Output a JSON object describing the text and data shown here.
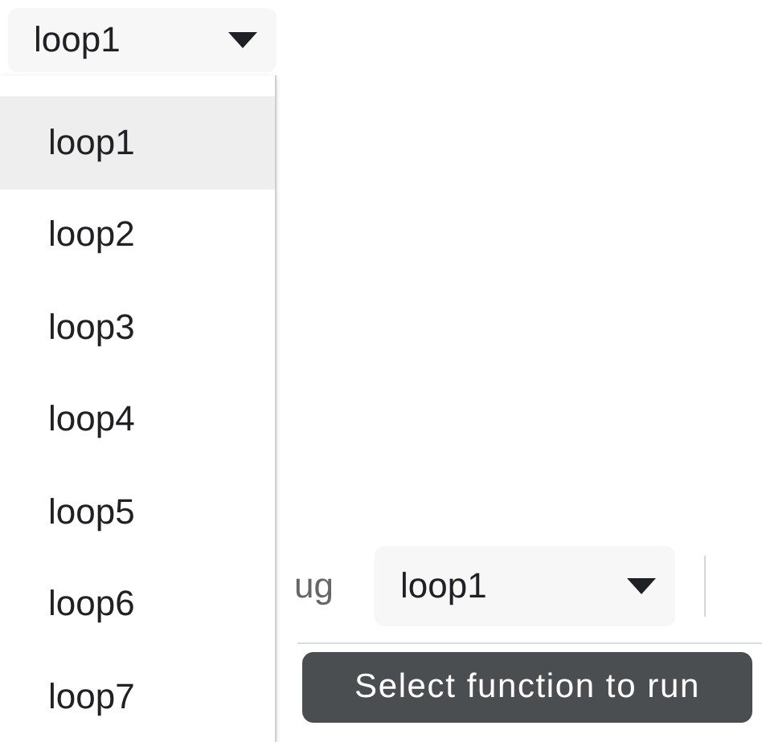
{
  "dropdown": {
    "value": "loop1",
    "expanded": true,
    "options": [
      {
        "label": "loop1",
        "selected": true
      },
      {
        "label": "loop2",
        "selected": false
      },
      {
        "label": "loop3",
        "selected": false
      },
      {
        "label": "loop4",
        "selected": false
      },
      {
        "label": "loop5",
        "selected": false
      },
      {
        "label": "loop6",
        "selected": false
      },
      {
        "label": "loop7",
        "selected": false
      }
    ]
  },
  "toolbar": {
    "label": "ug",
    "select": {
      "value": "loop1"
    }
  },
  "tooltip": {
    "text": "Select function to run"
  }
}
